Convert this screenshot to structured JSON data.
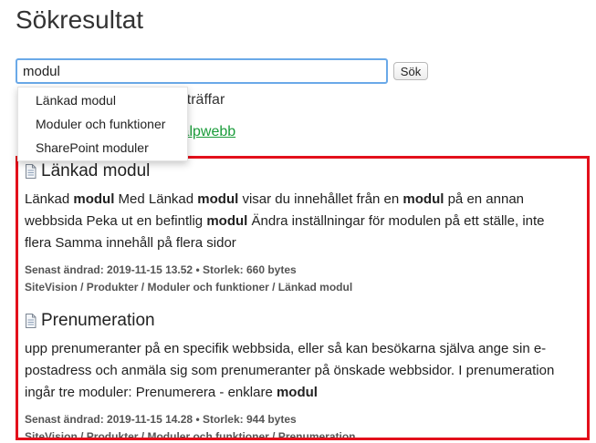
{
  "page": {
    "title": "Sökresultat"
  },
  "search": {
    "value": "modul",
    "button_label": "Sök"
  },
  "suggestions": [
    "Länkad modul",
    "Moduler och funktioner",
    "SharePoint moduler"
  ],
  "info": {
    "hits_partial": ")",
    "hits_label": " träffar",
    "help_link_partial": "jälpwebb"
  },
  "results": [
    {
      "title": "Länkad modul",
      "snippet": [
        {
          "t": "Länkad ",
          "b": false
        },
        {
          "t": "modul",
          "b": true
        },
        {
          "t": " Med Länkad ",
          "b": false
        },
        {
          "t": "modul",
          "b": true
        },
        {
          "t": " visar du innehållet från en ",
          "b": false
        },
        {
          "t": "modul",
          "b": true
        },
        {
          "t": " på en annan webbsida Peka ut en befintlig ",
          "b": false
        },
        {
          "t": "modul",
          "b": true
        },
        {
          "t": " Ändra inställningar för modulen på ett ställe, inte flera Samma innehåll på flera sidor",
          "b": false
        }
      ],
      "meta_line": "Senast ändrad: 2019-11-15 13.52 • Storlek: 660 bytes",
      "path": "SiteVision / Produkter / Moduler och funktioner / Länkad modul"
    },
    {
      "title": "Prenumeration",
      "snippet": [
        {
          "t": "upp prenumeranter på en specifik webbsida, eller så kan besökarna själva ange sin e-postadress och anmäla sig som prenumeranter på önskade webbsidor. I prenumeration ingår tre moduler: Prenumerera - enklare ",
          "b": false
        },
        {
          "t": "modul",
          "b": true
        }
      ],
      "meta_line": "Senast ändrad: 2019-11-15 14.28 • Storlek: 944 bytes",
      "path": "SiteVision / Produkter / Moduler och funktioner / Prenumeration"
    }
  ],
  "colors": {
    "highlight_border": "#e3101b",
    "link_green": "#1a9c3a",
    "input_focus": "#6aa9e8"
  },
  "icons": {
    "result_icon": "document-icon"
  }
}
